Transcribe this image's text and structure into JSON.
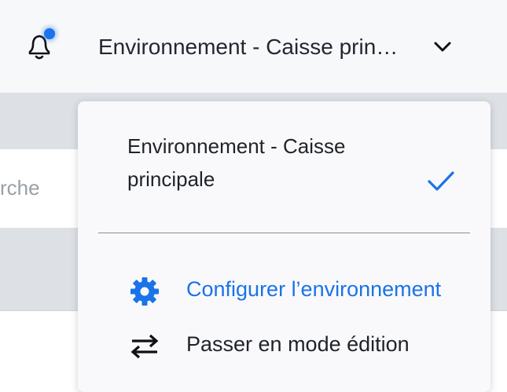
{
  "header": {
    "notification_icon": "bell-icon",
    "has_unread": true,
    "environment_label": "Environnement - Caisse prin…",
    "dropdown_icon": "chevron-down-icon"
  },
  "background": {
    "search_placeholder": "rche"
  },
  "menu": {
    "selected_option": {
      "label": "Environnement - Caisse principale",
      "selected": true,
      "check_icon": "check-icon"
    },
    "actions": [
      {
        "label": "Configurer l’environnement",
        "icon": "gear-icon",
        "color": "#1a73e8"
      },
      {
        "label": "Passer en mode édition",
        "icon": "swap-arrows-icon",
        "color": "#1f2329"
      }
    ]
  },
  "colors": {
    "accent": "#1a73e8",
    "text": "#1f2329",
    "header_bg": "#f7f8fa",
    "menu_bg": "#f9f9fc"
  }
}
